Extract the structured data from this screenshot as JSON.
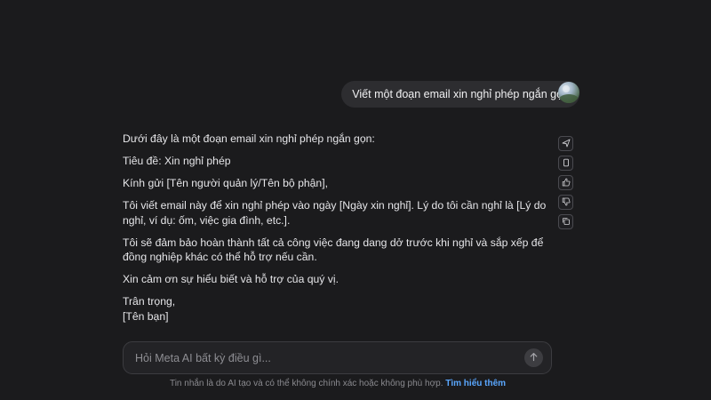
{
  "chat": {
    "user_message": "Viết một đoạn email xin nghỉ phép ngắn gọn",
    "assistant": {
      "intro": "Dưới đây là một đoạn email xin nghỉ phép ngắn gọn:",
      "subject": "Tiêu đề: Xin nghỉ phép",
      "greeting": "Kính gửi [Tên người quản lý/Tên bộ phận],",
      "body_1": "Tôi viết email này để xin nghỉ phép vào ngày [Ngày xin nghỉ]. Lý do tôi cần nghỉ là [Lý do nghỉ, ví dụ: ốm, việc gia đình, etc.].",
      "body_2": "Tôi sẽ đảm bảo hoàn thành tất cả công việc đang dang dở trước khi nghỉ và sắp xếp để đồng nghiệp khác có thể hỗ trợ nếu cần.",
      "thanks": "Xin cảm ơn sự hiểu biết và hỗ trợ của quý vị.",
      "closing": "Trân trọng,",
      "signature": "[Tên bạn]"
    },
    "actions": [
      {
        "icon": "share-icon"
      },
      {
        "icon": "copy-icon"
      },
      {
        "icon": "thumbs-up-icon"
      },
      {
        "icon": "thumbs-down-icon"
      },
      {
        "icon": "regenerate-icon"
      }
    ]
  },
  "composer": {
    "placeholder": "Hỏi Meta AI bất kỳ điều gì...",
    "send_icon": "arrow-up-icon"
  },
  "footer": {
    "disclaimer": "Tin nhắn là do AI tạo và có thể không chính xác hoặc không phù hợp.",
    "learn_more": "Tìm hiểu thêm"
  },
  "colors": {
    "background": "#1b1b1d",
    "bubble": "#2d2d30",
    "link": "#5aa7ff"
  }
}
